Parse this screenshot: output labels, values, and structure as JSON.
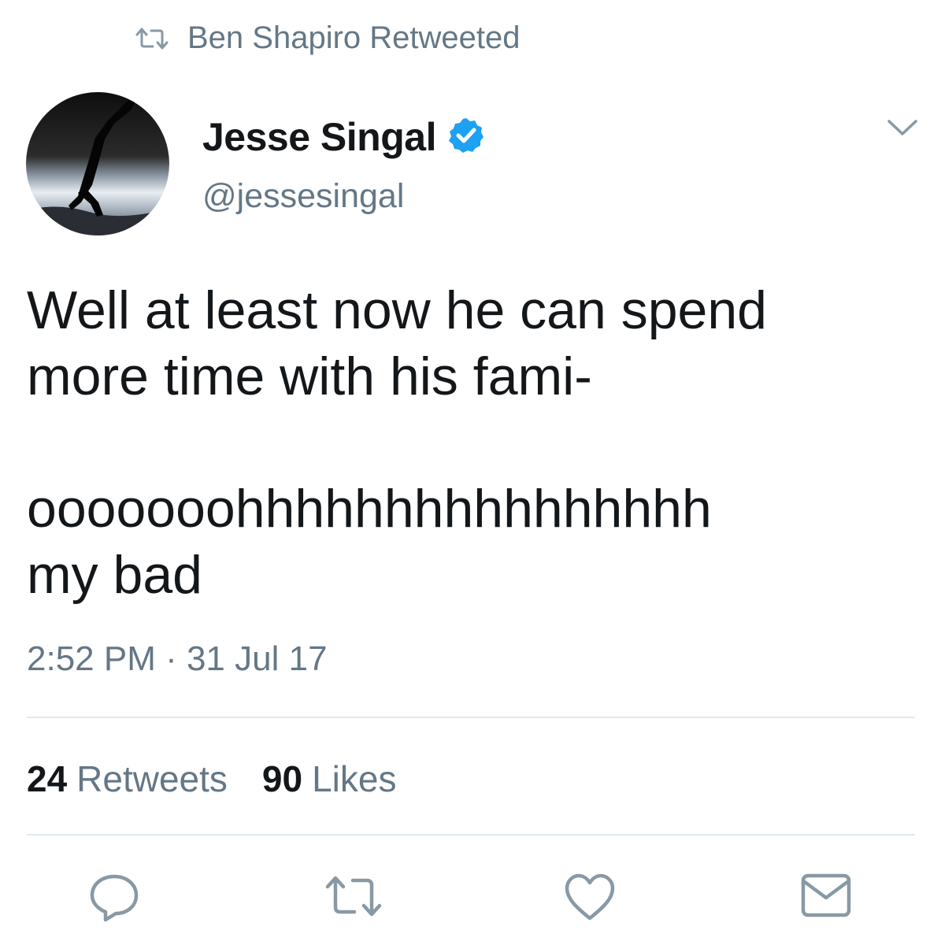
{
  "social_context": {
    "icon": "retweet-icon",
    "text": "Ben Shapiro Retweeted"
  },
  "author": {
    "display_name": "Jesse Singal",
    "handle": "@jessesingal",
    "verified_icon": "verified-badge-icon"
  },
  "tweet": {
    "text": "Well at least now he can spend\nmore time with his fami-\n\nooooooohhhhhhhhhhhhhhhh\nmy bad",
    "timestamp": "2:52 PM · 31 Jul 17"
  },
  "stats": {
    "retweets_count": "24",
    "retweets_label": "Retweets",
    "likes_count": "90",
    "likes_label": "Likes"
  },
  "actions": [
    "reply-icon",
    "retweet-icon",
    "like-icon",
    "direct-message-icon"
  ],
  "colors": {
    "text": "#14171a",
    "secondary": "#657786",
    "verified": "#1da1f2",
    "divider": "#e1e8ed"
  }
}
